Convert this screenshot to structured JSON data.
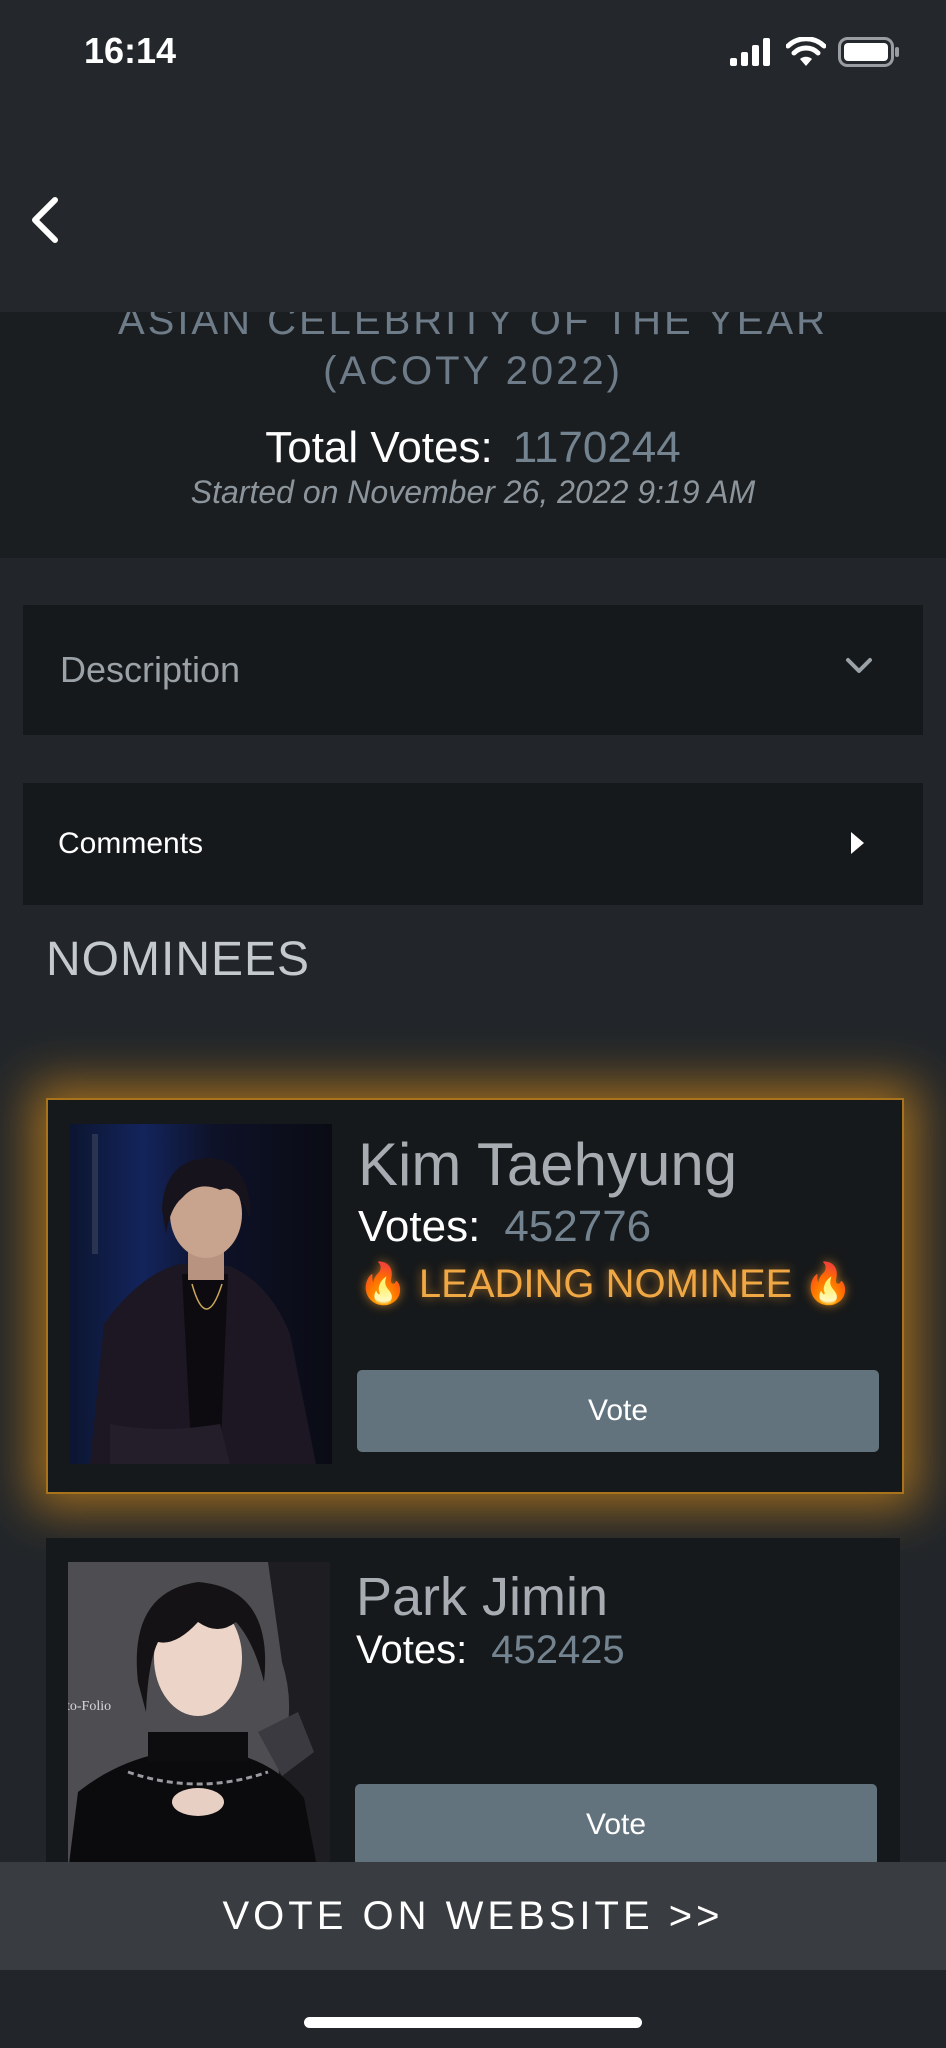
{
  "status_bar": {
    "time": "16:14"
  },
  "poll": {
    "title_line1": "ASIAN CELEBRITY OF THE YEAR",
    "title_line2": "(ACOTY 2022)",
    "total_votes_label": "Total Votes:",
    "total_votes_value": "1170244",
    "started_text": "Started on November 26, 2022 9:19 AM"
  },
  "sections": {
    "description_label": "Description",
    "comments_label": "Comments",
    "nominees_heading": "NOMINEES"
  },
  "nominees": [
    {
      "name": "Kim Taehyung",
      "votes_label": "Votes:",
      "votes_value": "452776",
      "badge": "🔥 LEADING NOMINEE 🔥",
      "vote_button": "Vote"
    },
    {
      "name": "Park Jimin",
      "votes_label": "Votes:",
      "votes_value": "452425",
      "vote_button": "Vote",
      "photo_caption": "to-Folio"
    }
  ],
  "bottom_cta": "VOTE ON WEBSITE >>",
  "colors": {
    "background": "#22262a",
    "panel": "#16191b",
    "accent_glow": "#ea9618",
    "button": "#63737e",
    "muted_value": "#73838f"
  },
  "icons": [
    "back-chevron-icon",
    "chevron-down-icon",
    "caret-right-icon",
    "signal-icon",
    "wifi-icon",
    "battery-icon",
    "fire-icon"
  ]
}
